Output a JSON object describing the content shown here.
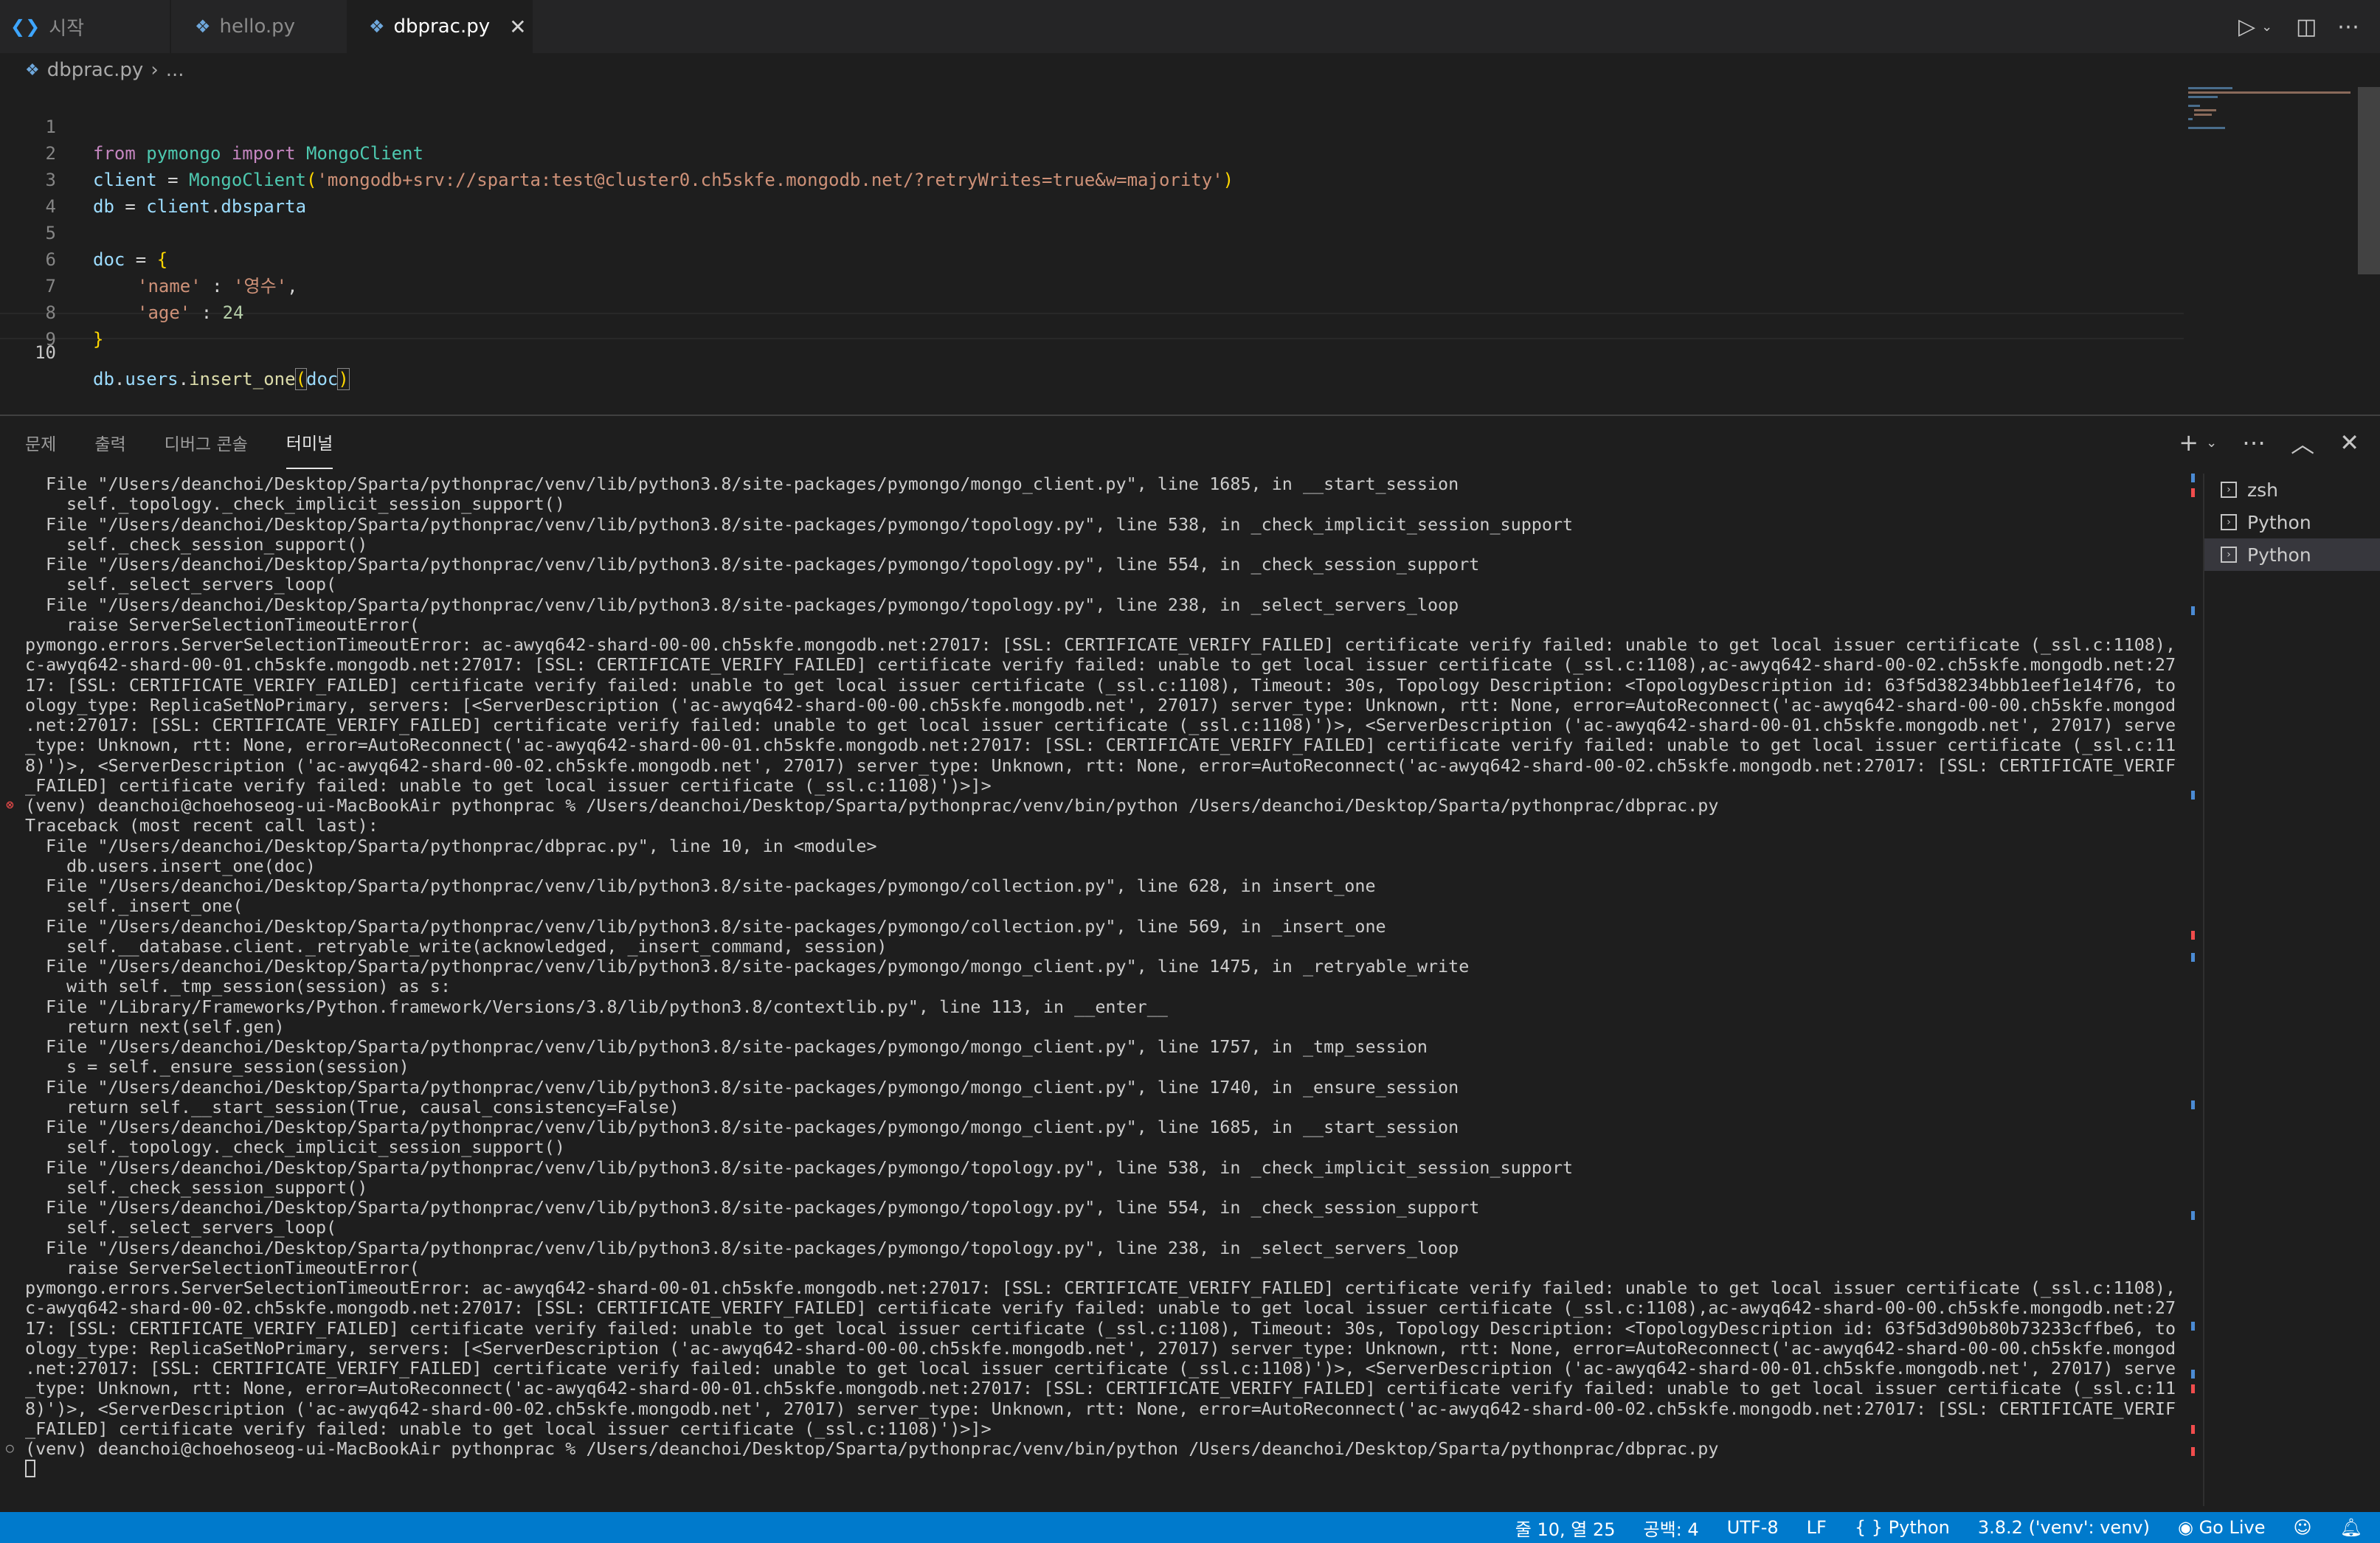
{
  "tabs": [
    {
      "label": "시작",
      "icon": "vscode-logo-icon"
    },
    {
      "label": "hello.py",
      "icon": "python-file-icon"
    },
    {
      "label": "dbprac.py",
      "icon": "python-file-icon",
      "active": true
    }
  ],
  "breadcrumb": {
    "file": "dbprac.py",
    "rest": "..."
  },
  "editor": {
    "line_numbers": [
      "1",
      "2",
      "3",
      "4",
      "5",
      "6",
      "7",
      "8",
      "9",
      "10"
    ],
    "lines": {
      "l1": {
        "kw1": "from",
        "mod": "pymongo",
        "kw2": "import",
        "cls": "MongoClient"
      },
      "l2": {
        "var": "client",
        "eq": " = ",
        "fn": "MongoClient",
        "open": "(",
        "str": "'mongodb+srv://sparta:test@cluster0.ch5skfe.mongodb.net/?retryWrites=true&w=majority'",
        "close": ")"
      },
      "l3": {
        "var": "db",
        "eq": " = ",
        "obj": "client",
        "dot": ".",
        "attr": "dbsparta"
      },
      "l5": {
        "var": "doc",
        "eq": " = ",
        "brace": "{"
      },
      "l6": {
        "key": "'name'",
        "sep": " : ",
        "val": "'영수'",
        "comma": ","
      },
      "l7": {
        "key": "'age'",
        "sep": " : ",
        "val": "24"
      },
      "l8": {
        "brace": "}"
      },
      "l10": {
        "obj": "db",
        "d1": ".",
        "attr": "users",
        "d2": ".",
        "fn": "insert_one",
        "open": "(",
        "arg": "doc",
        "close": ")"
      }
    }
  },
  "panel": {
    "tabs": [
      "문제",
      "출력",
      "디버그 콘솔",
      "터미널"
    ],
    "active_tab": "터미널"
  },
  "terminal": {
    "lines": [
      "File \"/Users/deanchoi/Desktop/Sparta/pythonprac/venv/lib/python3.8/site-packages/pymongo/mongo_client.py\", line 1685, in __start_session",
      "self._topology._check_implicit_session_support()",
      "File \"/Users/deanchoi/Desktop/Sparta/pythonprac/venv/lib/python3.8/site-packages/pymongo/topology.py\", line 538, in _check_implicit_session_support",
      "self._check_session_support()",
      "File \"/Users/deanchoi/Desktop/Sparta/pythonprac/venv/lib/python3.8/site-packages/pymongo/topology.py\", line 554, in _check_session_support",
      "self._select_servers_loop(",
      "File \"/Users/deanchoi/Desktop/Sparta/pythonprac/venv/lib/python3.8/site-packages/pymongo/topology.py\", line 238, in _select_servers_loop",
      "raise ServerSelectionTimeoutError(",
      "pymongo.errors.ServerSelectionTimeoutError: ac-awyq642-shard-00-00.ch5skfe.mongodb.net:27017: [SSL: CERTIFICATE_VERIFY_FAILED] certificate verify failed: unable to get local issuer certificate (_ssl.c:1108),a",
      "c-awyq642-shard-00-01.ch5skfe.mongodb.net:27017: [SSL: CERTIFICATE_VERIFY_FAILED] certificate verify failed: unable to get local issuer certificate (_ssl.c:1108),ac-awyq642-shard-00-02.ch5skfe.mongodb.net:270",
      "17: [SSL: CERTIFICATE_VERIFY_FAILED] certificate verify failed: unable to get local issuer certificate (_ssl.c:1108), Timeout: 30s, Topology Description: <TopologyDescription id: 63f5d38234bbb1eef1e14f76, top",
      "ology_type: ReplicaSetNoPrimary, servers: [<ServerDescription ('ac-awyq642-shard-00-00.ch5skfe.mongodb.net', 27017) server_type: Unknown, rtt: None, error=AutoReconnect('ac-awyq642-shard-00-00.ch5skfe.mongodb",
      ".net:27017: [SSL: CERTIFICATE_VERIFY_FAILED] certificate verify failed: unable to get local issuer certificate (_ssl.c:1108)')>, <ServerDescription ('ac-awyq642-shard-00-01.ch5skfe.mongodb.net', 27017) server",
      "_type: Unknown, rtt: None, error=AutoReconnect('ac-awyq642-shard-00-01.ch5skfe.mongodb.net:27017: [SSL: CERTIFICATE_VERIFY_FAILED] certificate verify failed: unable to get local issuer certificate (_ssl.c:110",
      "8)')>, <ServerDescription ('ac-awyq642-shard-00-02.ch5skfe.mongodb.net', 27017) server_type: Unknown, rtt: None, error=AutoReconnect('ac-awyq642-shard-00-02.ch5skfe.mongodb.net:27017: [SSL: CERTIFICATE_VERIFY",
      "_FAILED] certificate verify failed: unable to get local issuer certificate (_ssl.c:1108)')>]>",
      "(venv) deanchoi@choehoseog-ui-MacBookAir pythonprac % /Users/deanchoi/Desktop/Sparta/pythonprac/venv/bin/python /Users/deanchoi/Desktop/Sparta/pythonprac/dbprac.py",
      "Traceback (most recent call last):",
      "File \"/Users/deanchoi/Desktop/Sparta/pythonprac/dbprac.py\", line 10, in <module>",
      "db.users.insert_one(doc)",
      "File \"/Users/deanchoi/Desktop/Sparta/pythonprac/venv/lib/python3.8/site-packages/pymongo/collection.py\", line 628, in insert_one",
      "self._insert_one(",
      "File \"/Users/deanchoi/Desktop/Sparta/pythonprac/venv/lib/python3.8/site-packages/pymongo/collection.py\", line 569, in _insert_one",
      "self.__database.client._retryable_write(acknowledged, _insert_command, session)",
      "File \"/Users/deanchoi/Desktop/Sparta/pythonprac/venv/lib/python3.8/site-packages/pymongo/mongo_client.py\", line 1475, in _retryable_write",
      "with self._tmp_session(session) as s:",
      "File \"/Library/Frameworks/Python.framework/Versions/3.8/lib/python3.8/contextlib.py\", line 113, in __enter__",
      "return next(self.gen)",
      "File \"/Users/deanchoi/Desktop/Sparta/pythonprac/venv/lib/python3.8/site-packages/pymongo/mongo_client.py\", line 1757, in _tmp_session",
      "s = self._ensure_session(session)",
      "File \"/Users/deanchoi/Desktop/Sparta/pythonprac/venv/lib/python3.8/site-packages/pymongo/mongo_client.py\", line 1740, in _ensure_session",
      "return self.__start_session(True, causal_consistency=False)",
      "File \"/Users/deanchoi/Desktop/Sparta/pythonprac/venv/lib/python3.8/site-packages/pymongo/mongo_client.py\", line 1685, in __start_session",
      "self._topology._check_implicit_session_support()",
      "File \"/Users/deanchoi/Desktop/Sparta/pythonprac/venv/lib/python3.8/site-packages/pymongo/topology.py\", line 538, in _check_implicit_session_support",
      "self._check_session_support()",
      "File \"/Users/deanchoi/Desktop/Sparta/pythonprac/venv/lib/python3.8/site-packages/pymongo/topology.py\", line 554, in _check_session_support",
      "self._select_servers_loop(",
      "File \"/Users/deanchoi/Desktop/Sparta/pythonprac/venv/lib/python3.8/site-packages/pymongo/topology.py\", line 238, in _select_servers_loop",
      "raise ServerSelectionTimeoutError(",
      "pymongo.errors.ServerSelectionTimeoutError: ac-awyq642-shard-00-01.ch5skfe.mongodb.net:27017: [SSL: CERTIFICATE_VERIFY_FAILED] certificate verify failed: unable to get local issuer certificate (_ssl.c:1108),a",
      "c-awyq642-shard-00-02.ch5skfe.mongodb.net:27017: [SSL: CERTIFICATE_VERIFY_FAILED] certificate verify failed: unable to get local issuer certificate (_ssl.c:1108),ac-awyq642-shard-00-00.ch5skfe.mongodb.net:270",
      "17: [SSL: CERTIFICATE_VERIFY_FAILED] certificate verify failed: unable to get local issuer certificate (_ssl.c:1108), Timeout: 30s, Topology Description: <TopologyDescription id: 63f5d3d90b80b73233cffbe6, top",
      "ology_type: ReplicaSetNoPrimary, servers: [<ServerDescription ('ac-awyq642-shard-00-00.ch5skfe.mongodb.net', 27017) server_type: Unknown, rtt: None, error=AutoReconnect('ac-awyq642-shard-00-00.ch5skfe.mongodb",
      ".net:27017: [SSL: CERTIFICATE_VERIFY_FAILED] certificate verify failed: unable to get local issuer certificate (_ssl.c:1108)')>, <ServerDescription ('ac-awyq642-shard-00-01.ch5skfe.mongodb.net', 27017) server",
      "_type: Unknown, rtt: None, error=AutoReconnect('ac-awyq642-shard-00-01.ch5skfe.mongodb.net:27017: [SSL: CERTIFICATE_VERIFY_FAILED] certificate verify failed: unable to get local issuer certificate (_ssl.c:110",
      "8)')>, <ServerDescription ('ac-awyq642-shard-00-02.ch5skfe.mongodb.net', 27017) server_type: Unknown, rtt: None, error=AutoReconnect('ac-awyq642-shard-00-02.ch5skfe.mongodb.net:27017: [SSL: CERTIFICATE_VERIFY",
      "_FAILED] certificate verify failed: unable to get local issuer certificate (_ssl.c:1108)')>]>",
      "(venv) deanchoi@choehoseog-ui-MacBookAir pythonprac % /Users/deanchoi/Desktop/Sparta/pythonprac/venv/bin/python /Users/deanchoi/Desktop/Sparta/pythonprac/dbprac.py"
    ]
  },
  "terminal_list": [
    "zsh",
    "Python",
    "Python"
  ],
  "statusbar": {
    "position": "줄 10, 열 25",
    "spaces": "공백: 4",
    "encoding": "UTF-8",
    "eol": "LF",
    "language": "Python",
    "interpreter": "3.8.2 ('venv': venv)",
    "golive": "Go Live"
  },
  "colors": {
    "accent": "#007acc",
    "error": "#f14c4c",
    "editor_bg": "#1e1e1e"
  }
}
